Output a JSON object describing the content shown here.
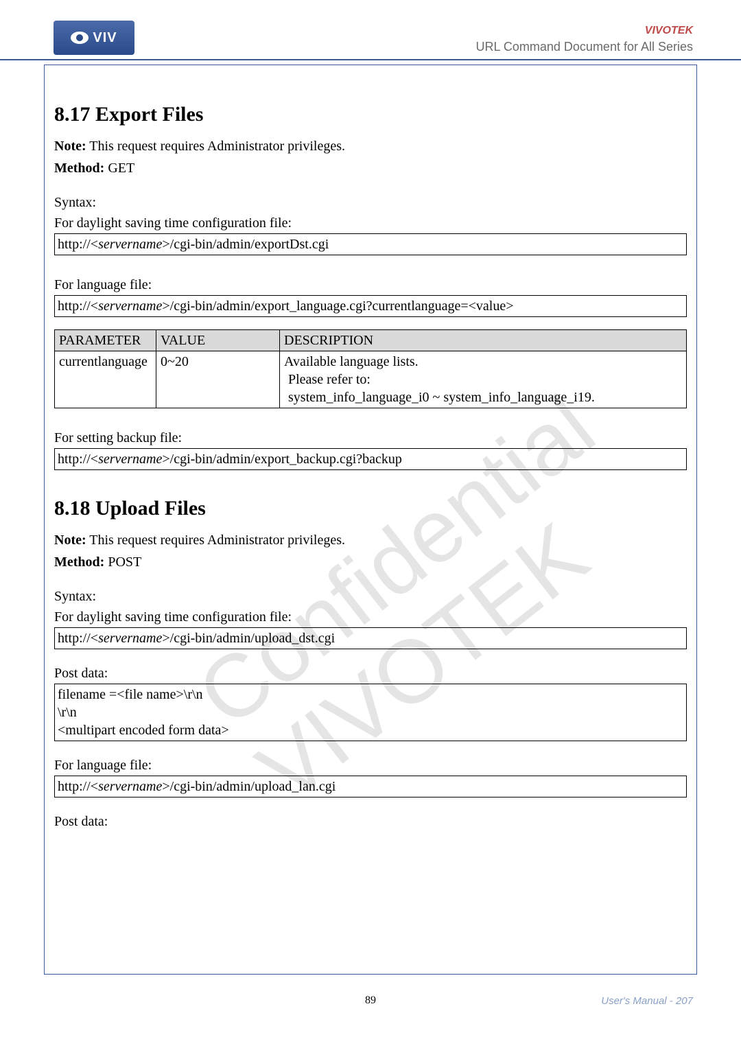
{
  "header": {
    "logo_text": "VIV",
    "brand_top": "VIVOTEK",
    "brand_sub": "URL Command Document for All Series"
  },
  "section_817": {
    "title": "8.17 Export Files",
    "note_label": "Note:",
    "note_text": " This request requires Administrator privileges.",
    "method_label": "Method:",
    "method_value": " GET",
    "syntax_label": "Syntax:",
    "dst_label": "For daylight saving time configuration file:",
    "dst_url_pre": "http://<",
    "dst_url_srv": "servername",
    "dst_url_post": ">/cgi-bin/admin/exportDst.cgi",
    "lang_label": "For language file:",
    "lang_url_pre": "http://<",
    "lang_url_srv": "servername",
    "lang_url_post": ">/cgi-bin/admin/export_language.cgi?currentlanguage=<value>",
    "table": {
      "h_param": "PARAMETER",
      "h_value": "VALUE",
      "h_desc": "DESCRIPTION",
      "r1_param": "currentlanguage",
      "r1_value": "0~20",
      "r1_desc_l1": "Available language lists.",
      "r1_desc_l2": "Please refer to:",
      "r1_desc_l3": "system_info_language_i0 ~ system_info_language_i19."
    },
    "backup_label": "For setting backup file:",
    "backup_url_pre": "http://<",
    "backup_url_srv": "servername",
    "backup_url_post": ">/cgi-bin/admin/export_backup.cgi?backup"
  },
  "section_818": {
    "title": "8.18 Upload Files",
    "note_label": "Note:",
    "note_text": " This request requires Administrator privileges.",
    "method_label": "Method:",
    "method_value": " POST",
    "syntax_label": "Syntax:",
    "dst_label": "For daylight saving time configuration file:",
    "dst_url_pre": "http://<",
    "dst_url_srv": "servername",
    "dst_url_post": ">/cgi-bin/admin/upload_dst.cgi",
    "post_label": "Post data:",
    "post_block_l1": "filename =<file name>\\r\\n",
    "post_block_l2": "\\r\\n",
    "post_block_l3": "<multipart encoded form data>",
    "lang_label": "For language file:",
    "lang_url_pre": "http://<",
    "lang_url_srv": "servername",
    "lang_url_post": ">/cgi-bin/admin/upload_lan.cgi",
    "post_label2": "Post data:"
  },
  "footer": {
    "page_num": "89",
    "manual": "User's Manual - 207"
  }
}
